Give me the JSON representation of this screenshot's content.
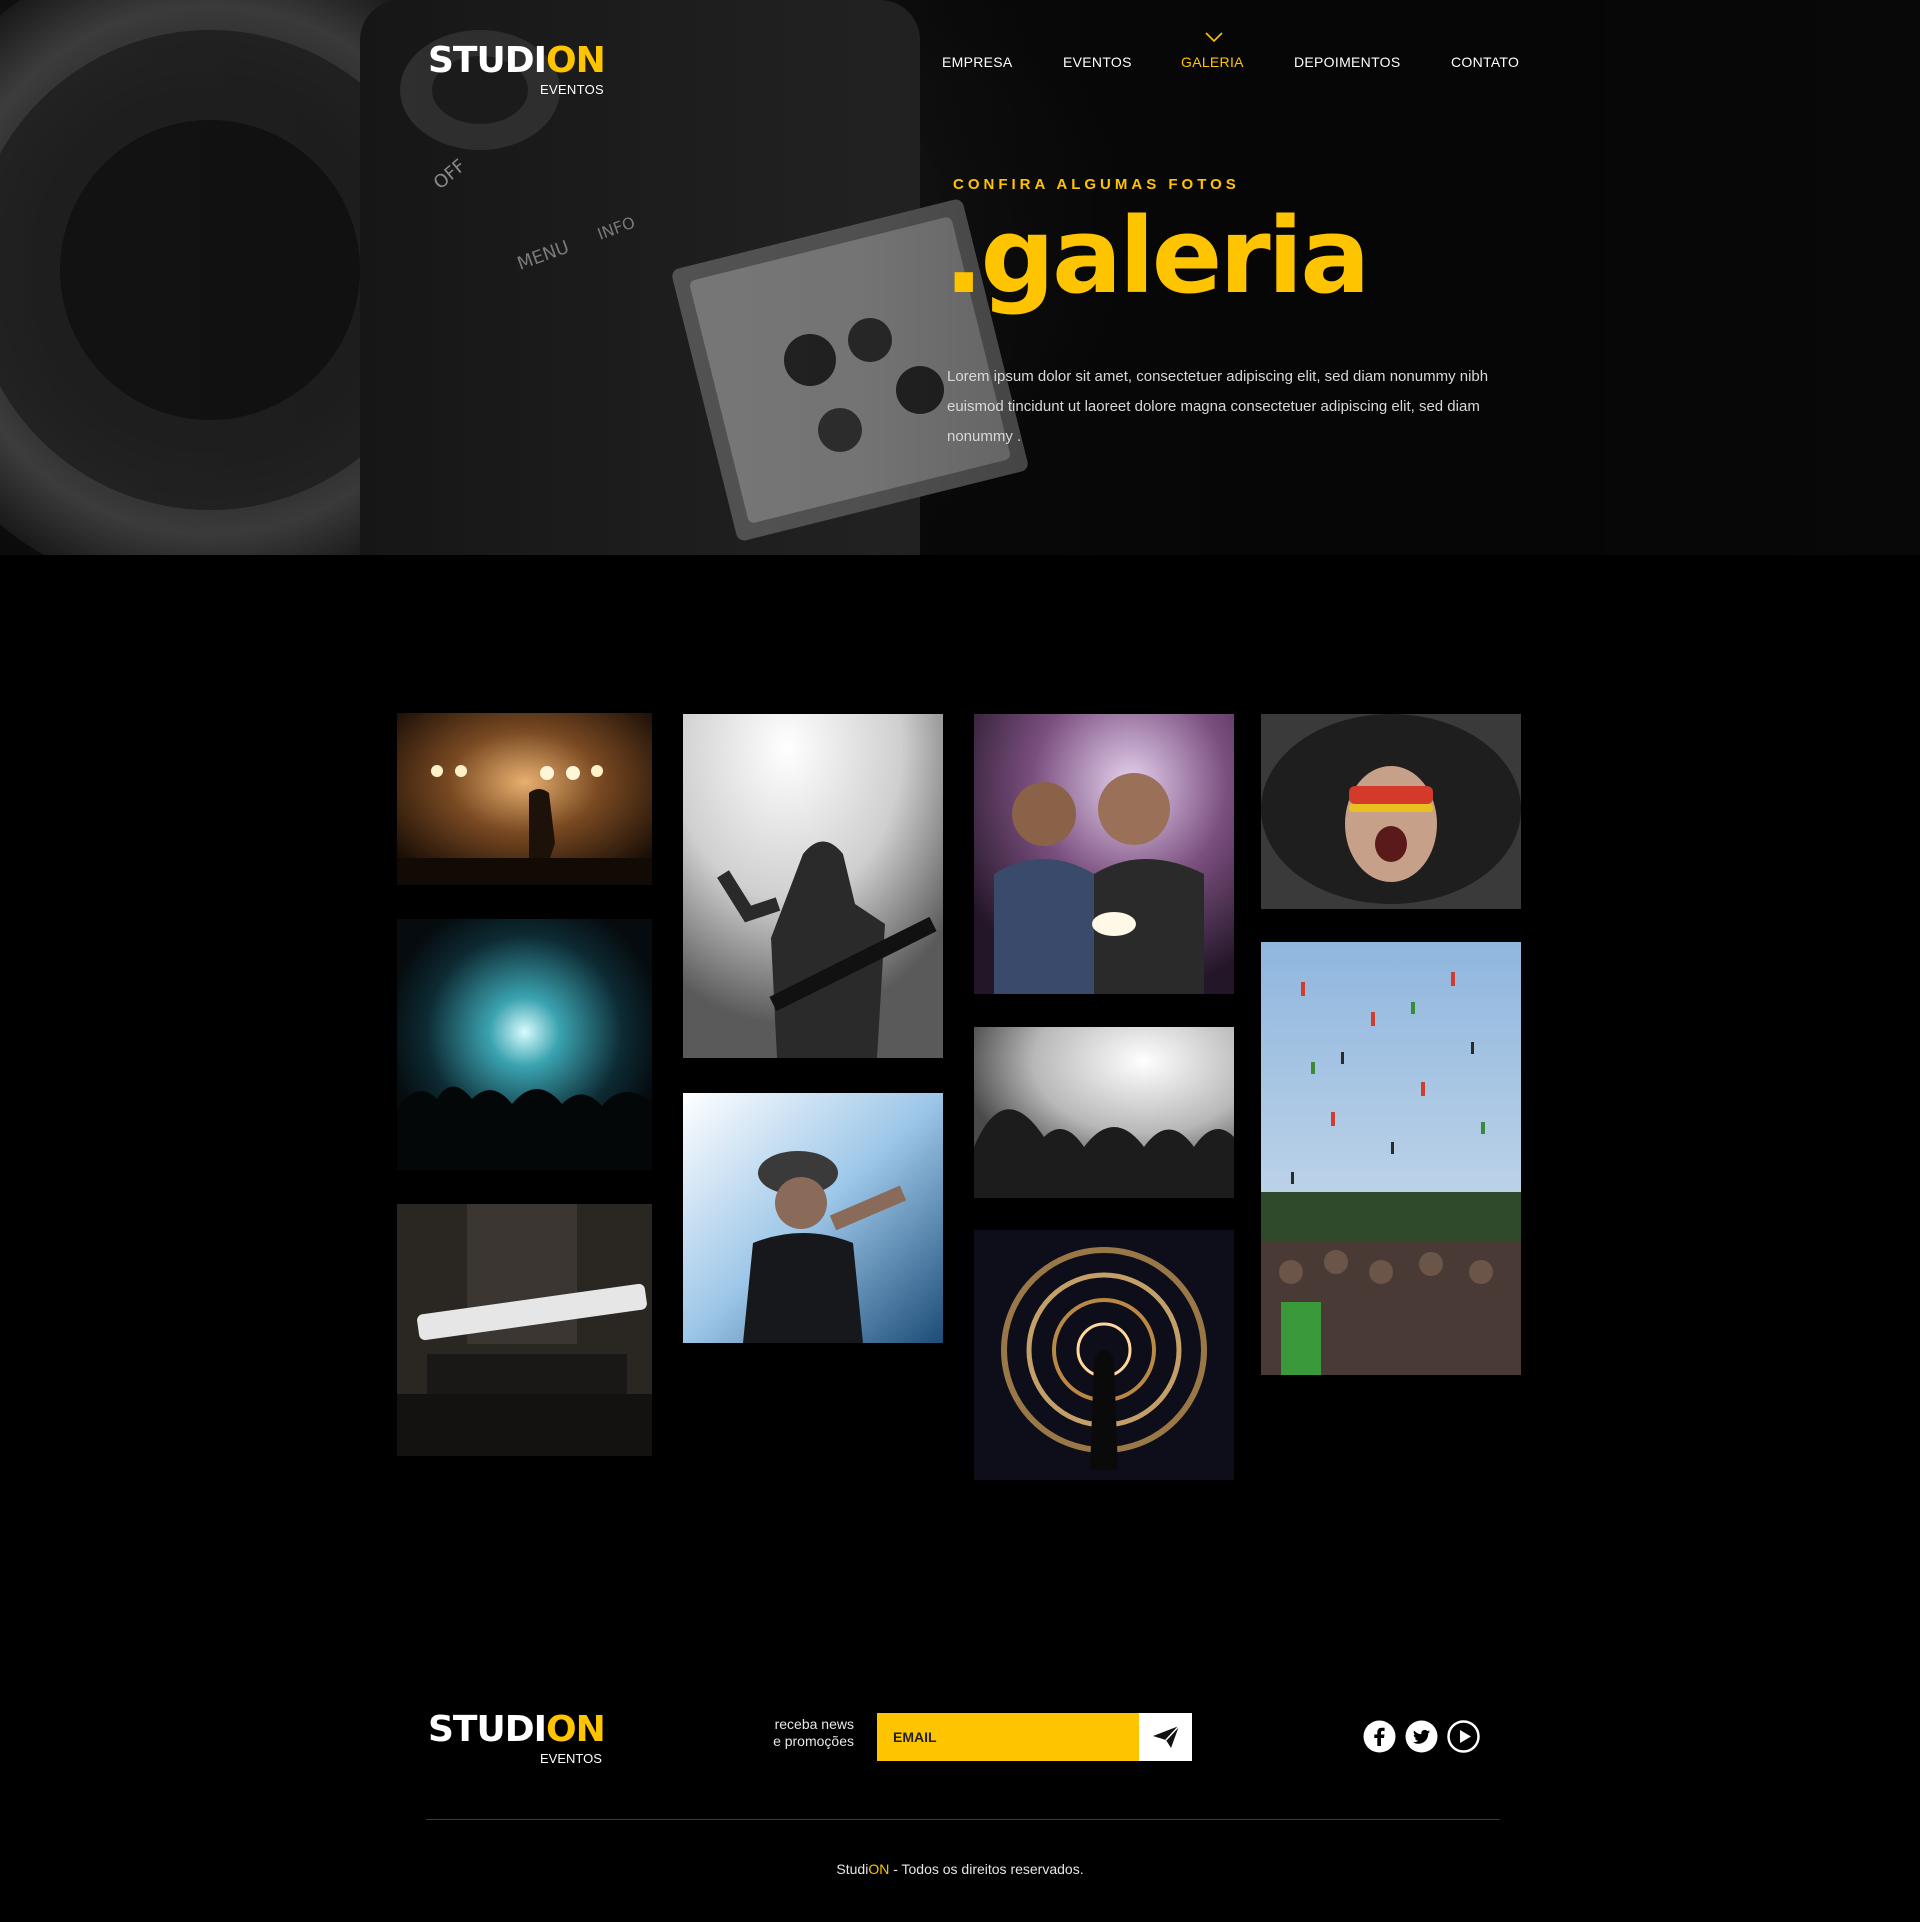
{
  "brand": {
    "name_main": "STUDI",
    "name_accent": "ON",
    "tagline": "EVENTOS"
  },
  "nav": {
    "items": [
      {
        "label": "EMPRESA",
        "active": false
      },
      {
        "label": "EVENTOS",
        "active": false
      },
      {
        "label": "GALERIA",
        "active": true
      },
      {
        "label": "DEPOIMENTOS",
        "active": false
      },
      {
        "label": "CONTATO",
        "active": false
      }
    ]
  },
  "hero": {
    "kicker": "CONFIRA ALGUMAS FOTOS",
    "title": ".galeria",
    "text": "Lorem ipsum dolor sit amet, consectetuer adipiscing elit, sed diam nonummy nibh euismod tincidunt ut laoreet dolore magna consectetuer adipiscing elit, sed diam nonummy ."
  },
  "gallery": {
    "photos": [
      {
        "subject": "concert-stage-lights"
      },
      {
        "subject": "crowd-blue-lights"
      },
      {
        "subject": "guitarist-seated"
      },
      {
        "subject": "bw-guitarist"
      },
      {
        "subject": "singer-cap"
      },
      {
        "subject": "duo-singers"
      },
      {
        "subject": "bw-crowd"
      },
      {
        "subject": "fire-spin"
      },
      {
        "subject": "screaming-face"
      },
      {
        "subject": "festival-crowd"
      }
    ]
  },
  "footer": {
    "news_label_line1": "receba news",
    "news_label_line2": "e promoções",
    "email_placeholder": "EMAIL",
    "social": [
      {
        "icon": "facebook-icon"
      },
      {
        "icon": "twitter-icon"
      },
      {
        "icon": "youtube-icon"
      }
    ],
    "copyright_main": "Studi",
    "copyright_accent": "ON",
    "copyright_rest": " - Todos os direitos reservados."
  },
  "colors": {
    "accent": "#ffc400",
    "background": "#000000",
    "text": "#ffffff"
  }
}
